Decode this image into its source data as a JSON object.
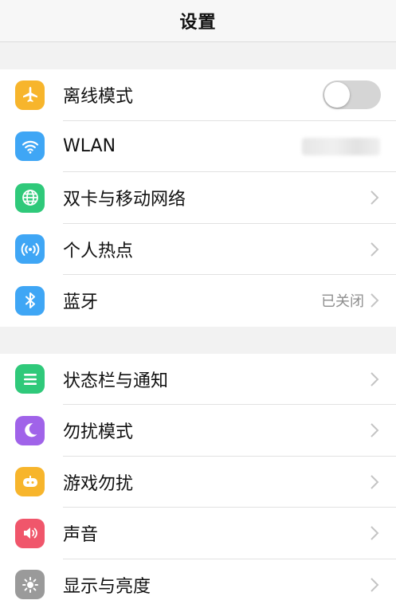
{
  "header": {
    "title": "设置"
  },
  "group1": [
    {
      "label": "离线模式",
      "icon": "airplane-icon",
      "color": "#f7b52c",
      "control": "toggle",
      "toggle_on": false
    },
    {
      "label": "WLAN",
      "icon": "wifi-icon",
      "color": "#3fa6f5",
      "control": "hidden-value"
    },
    {
      "label": "双卡与移动网络",
      "icon": "globe-icon",
      "color": "#2fc97a",
      "control": "chevron"
    },
    {
      "label": "个人热点",
      "icon": "hotspot-icon",
      "color": "#3fa6f5",
      "control": "chevron"
    },
    {
      "label": "蓝牙",
      "icon": "bluetooth-icon",
      "color": "#3fa6f5",
      "control": "chevron",
      "value": "已关闭"
    }
  ],
  "group2": [
    {
      "label": "状态栏与通知",
      "icon": "notification-list-icon",
      "color": "#2fc97a",
      "control": "chevron"
    },
    {
      "label": "勿扰模式",
      "icon": "moon-icon",
      "color": "#a063e9",
      "control": "chevron"
    },
    {
      "label": "游戏勿扰",
      "icon": "game-controller-icon",
      "color": "#f7b52c",
      "control": "chevron"
    },
    {
      "label": "声音",
      "icon": "speaker-icon",
      "color": "#f0566b",
      "control": "chevron"
    },
    {
      "label": "显示与亮度",
      "icon": "brightness-icon",
      "color": "#9a9a9a",
      "control": "chevron"
    }
  ]
}
